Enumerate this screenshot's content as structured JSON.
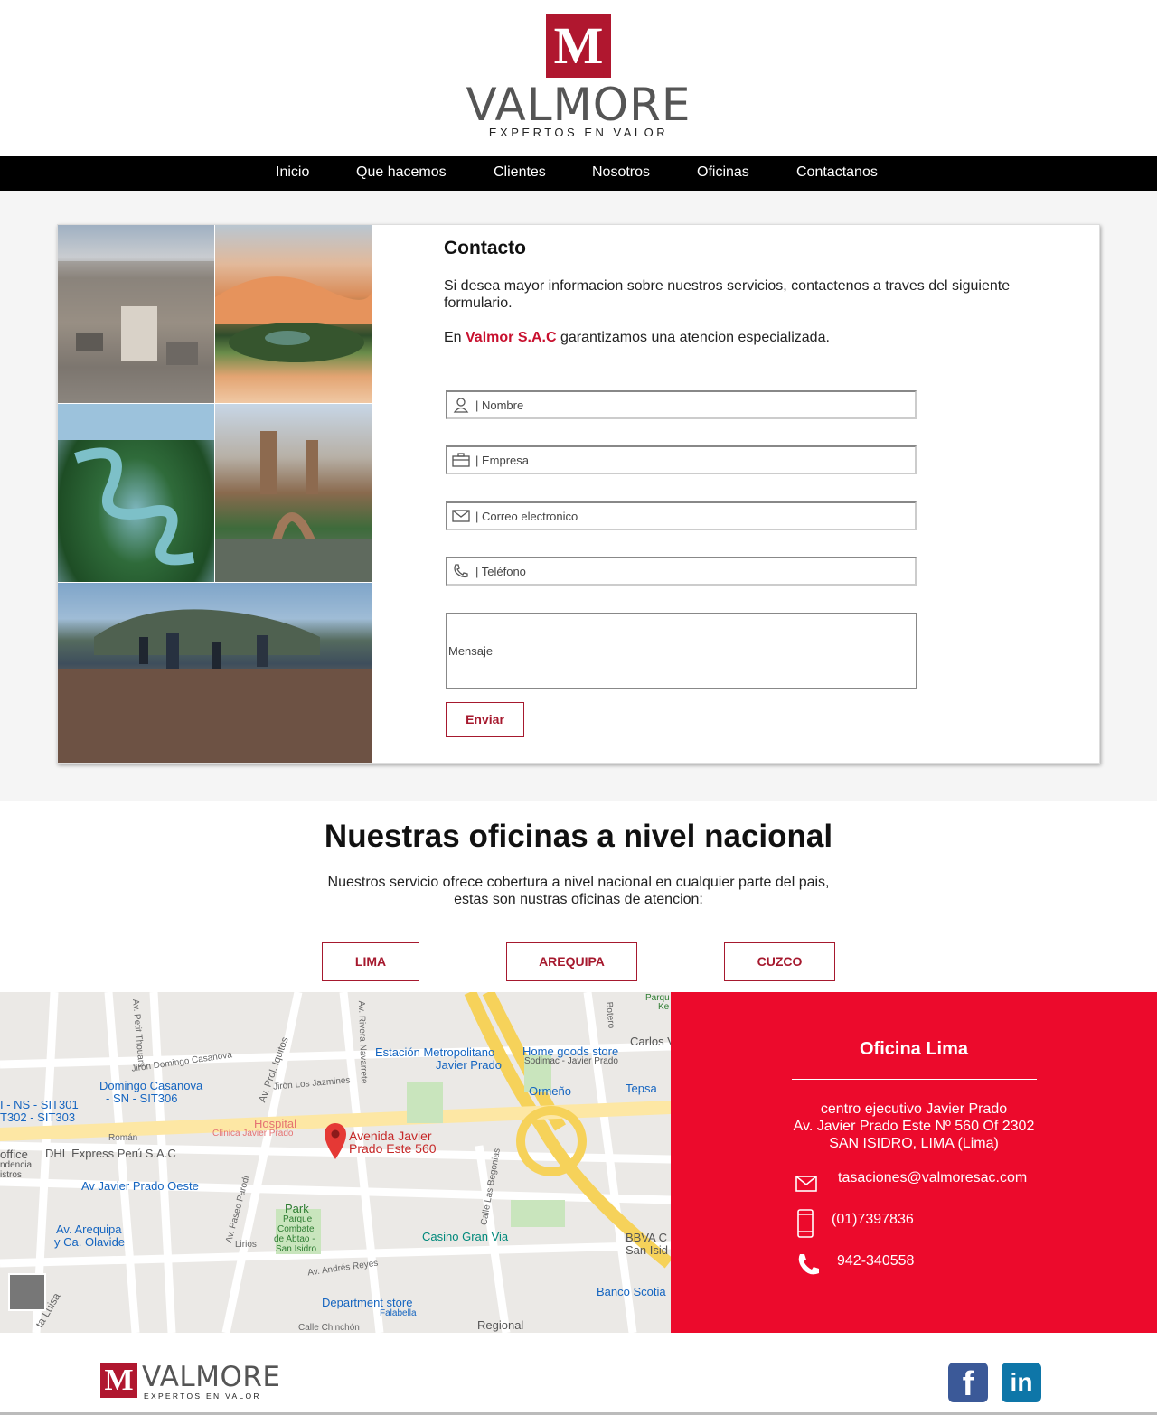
{
  "brand": {
    "name": "VALMORE",
    "mark": "M",
    "tagline": "EXPERTOS EN VALOR"
  },
  "nav": {
    "items": [
      {
        "label": "Inicio"
      },
      {
        "label": "Que hacemos"
      },
      {
        "label": "Clientes"
      },
      {
        "label": "Nosotros"
      },
      {
        "label": "Oficinas"
      },
      {
        "label": "Contactanos"
      }
    ]
  },
  "contact": {
    "title": "Contacto",
    "intro": "Si desea mayor informacion sobre nuestros servicios, contactenos a traves del siguiente formulario.",
    "guarantee_prefix": "En ",
    "guarantee_brand": "Valmor S.A.C",
    "guarantee_suffix": " garantizamos una atencion especializada.",
    "fields": {
      "name": "| Nombre",
      "company": "| Empresa",
      "email": "| Correo electronico",
      "phone": "| Teléfono",
      "message": "Mensaje"
    },
    "send_label": "Enviar"
  },
  "offices": {
    "heading": "Nuestras oficinas a nivel nacional",
    "desc_line1": "Nuestros servicio ofrece cobertura a nivel nacional en cualquier parte del pais,",
    "desc_line2": "estas son nustras oficinas de atencion:",
    "cities": [
      "LIMA",
      "AREQUIPA",
      "CUZCO"
    ]
  },
  "map": {
    "pin_label_line1": "Avenida Javier",
    "pin_label_line2": "Prado Este 560",
    "labels": [
      "Estación Metropolitano",
      "Javier Prado",
      "Home goods store",
      "Sodimac - Javier Prado",
      "Carlos V",
      "Ormeño",
      "Tepsa",
      "Hospital",
      "Clínica Javier Prado",
      "Domingo Casanova",
      "- SN - SIT306",
      "I - NS - SIT301",
      "T302 - SIT303",
      "DHL Express Perú S.A.C",
      "office",
      "Av Javier Prado Oeste",
      "Park",
      "Parque",
      "Combate",
      "de Abtao -",
      "San Isidro",
      "Casino Gran Via",
      "BBVA C",
      "San Isid",
      "Av. Arequipa",
      "y Ca. Olavide",
      "Department store",
      "Falabella",
      "Banco Scotia",
      "Regional",
      "Jirón Domingo Casanova",
      "Jirón Los Jazmines",
      "Av. Prol. Iquitos",
      "Av. Petit Thouars",
      "Av. Rivera Navarrete",
      "Calle Las Begonias",
      "Av. Andrés Reyes",
      "Lirios",
      "Román",
      "Botero",
      "Parqu",
      "Ke",
      "Av. Paseo Parodi",
      "Calle Chinchón",
      "ta Luisa",
      "ndencia",
      "istros"
    ]
  },
  "office_card": {
    "title": "Oficina Lima",
    "address_line1": "centro ejecutivo Javier Prado",
    "address_line2": "Av. Javier Prado Este Nº 560 Of 2302",
    "address_line3": "SAN ISIDRO, LIMA (Lima)",
    "email": "tasaciones@valmoresac.com",
    "phone": "(01)7397836",
    "mobile": "942-340558"
  },
  "footer": {
    "brand": "VALMORE",
    "mark": "M",
    "tagline": "EXPERTOS EN VALOR",
    "facebook_glyph": "f",
    "linkedin_glyph": "in"
  },
  "colors": {
    "brand_red": "#b0172f",
    "accent_red": "#ec0a2c",
    "nav_bg": "#000000"
  }
}
